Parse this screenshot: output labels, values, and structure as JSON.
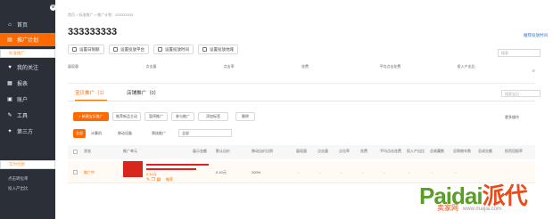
{
  "sidebar": {
    "items": [
      {
        "icon": "home-icon",
        "glyph": "⌂",
        "label": "首页"
      },
      {
        "icon": "promote-icon",
        "glyph": "▤",
        "label": "推广计划"
      },
      {
        "icon": "heart-icon",
        "glyph": "♥",
        "label": "我的关注"
      },
      {
        "icon": "report-icon",
        "glyph": "▦",
        "label": "报表"
      },
      {
        "icon": "account-icon",
        "glyph": "▣",
        "label": "账户"
      },
      {
        "icon": "tools-icon",
        "glyph": "✎",
        "label": "工具"
      },
      {
        "icon": "thirdparty-icon",
        "glyph": "✦",
        "label": "第三方"
      }
    ],
    "sub_active": "标准推广",
    "bottom_items": [
      "实时付款",
      "点击转化率",
      "投入产出比"
    ]
  },
  "breadcrumb": "首页 > 标准推广 > 推广计划：333333333",
  "title": "333333333",
  "top_right_link": "推荐投放时间",
  "toolbar": [
    "设置日限额",
    "设置投放平台",
    "设置投放时间",
    "设置投放地域"
  ],
  "search_placeholder": "搜索",
  "stats": [
    "展现量",
    "点击量",
    "点击率",
    "花费",
    "平均点击花费",
    "投入产出比"
  ],
  "stats_settings": "⚙",
  "tabs": [
    "宝贝推广（1）",
    "店铺推广（0）"
  ],
  "tab_search_placeholder": "搜索宝贝",
  "actions": [
    "+ 新建宝贝推广",
    "推荐新品主动",
    "暂停推广",
    "参与推广",
    "添加标签",
    "删除"
  ],
  "actions_right": "更多操作",
  "filter": {
    "status": "全部",
    "type": "计算机",
    "adjust": "移动设备",
    "tag_label": "筛选推广",
    "tag_value": "全部"
  },
  "table_headers": [
    "状态",
    "推广单元",
    "展示金额",
    "默认出价",
    "移动出价比例",
    "展现量",
    "点击量",
    "点击率",
    "花费",
    "平均点击花费",
    "投入产出比",
    "总收藏数",
    "总购物车数",
    "总成交额",
    "投资回报率"
  ],
  "row": {
    "status": "推广中",
    "bid": "0.10元",
    "bid_mobile": "0.10元",
    "ratio": "100%",
    "dash": "-",
    "link": "推荐"
  },
  "watermark": {
    "brand_en": "Paidai",
    "brand_cn": "派代",
    "sub_cn": "卖家网",
    "sub_url": "www.maijia.com"
  }
}
